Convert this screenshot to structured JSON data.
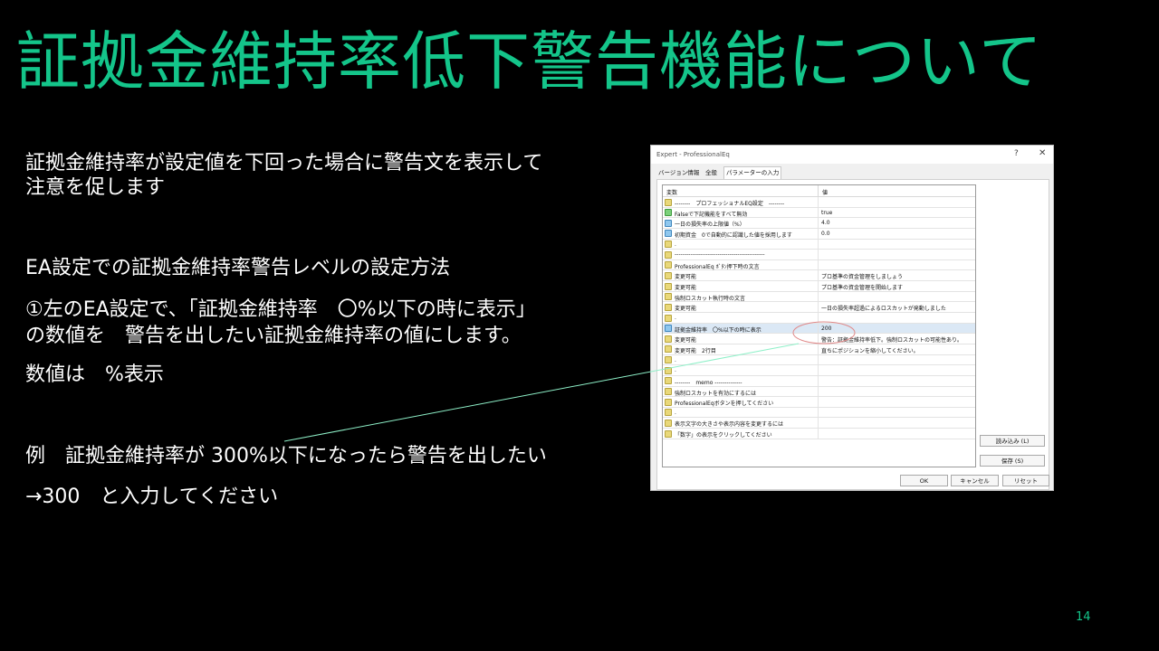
{
  "slide": {
    "title": "証拠金維持率低下警告機能について",
    "page_number": "14",
    "lines": {
      "l1": "証拠金維持率が設定値を下回った場合に警告文を表示して",
      "l2": "注意を促します",
      "l3": "EA設定での証拠金維持率警告レベルの設定方法",
      "l4": "①左のEA設定で、「証拠金維持率　〇%以下の時に表示」",
      "l5": "の数値を　警告を出したい証拠金維持率の値にします。",
      "l6": "数値は　%表示",
      "l7": "例　証拠金維持率が 300%以下になったら警告を出したい",
      "l8": "→300　と入力してください"
    }
  },
  "dialog": {
    "title": "Expert - ProfessionalEq",
    "help": "?",
    "close": "✕",
    "tabs": [
      "バージョン情報",
      "全般",
      "パラメーターの入力"
    ],
    "columns": [
      "変数",
      "値"
    ],
    "rows": [
      {
        "icon": "ab",
        "name": "--------　プロフェッショナルEQ設定　--------",
        "value": ""
      },
      {
        "icon": "bool",
        "name": "Falseで下記機能をすべて無効",
        "value": "true"
      },
      {
        "icon": "num",
        "name": "一日の損失率の上限値（%）",
        "value": "4.0"
      },
      {
        "icon": "num",
        "name": "初期資金　0で自動的に認識した値を採用します",
        "value": "0.0"
      },
      {
        "icon": "ab",
        "name": ".",
        "value": ""
      },
      {
        "icon": "ab",
        "name": "----------------------------------------------",
        "value": ""
      },
      {
        "icon": "ab",
        "name": "ProfessionalEq ﾎﾞﾀﾝ押下時の文言",
        "value": ""
      },
      {
        "icon": "ab",
        "name": "変更可能",
        "value": "プロ基準の資金管理をしましょう"
      },
      {
        "icon": "ab",
        "name": "変更可能",
        "value": "プロ基準の資金管理を開始します"
      },
      {
        "icon": "ab",
        "name": "強制ロスカット執行時の文言",
        "value": ""
      },
      {
        "icon": "ab",
        "name": "変更可能",
        "value": "一日の損失率超過によるロスカットが発動しました"
      },
      {
        "icon": "ab",
        "name": ".",
        "value": ""
      },
      {
        "icon": "num",
        "name": "証拠金維持率　〇%以下の時に表示",
        "value": "200"
      },
      {
        "icon": "ab",
        "name": "変更可能",
        "value": "警告：証拠金維持率低下。強制ロスカットの可能性あり。"
      },
      {
        "icon": "ab",
        "name": "変更可能　2行目",
        "value": "直ちにポジションを縮小してください。"
      },
      {
        "icon": "ab",
        "name": ".",
        "value": ""
      },
      {
        "icon": "ab",
        "name": ".",
        "value": ""
      },
      {
        "icon": "ab",
        "name": "--------　memo --------------",
        "value": ""
      },
      {
        "icon": "ab",
        "name": "強制ロスカットを有効にするには",
        "value": ""
      },
      {
        "icon": "ab",
        "name": "ProfessionalEqボタンを押してください",
        "value": ""
      },
      {
        "icon": "ab",
        "name": ".",
        "value": ""
      },
      {
        "icon": "ab",
        "name": "表示文字の大きさや表示内容を変更するには",
        "value": ""
      },
      {
        "icon": "ab",
        "name": "「数字」の表示をクリックしてください",
        "value": ""
      }
    ],
    "buttons": {
      "load": "読み込み (L)",
      "save": "保存 (S)",
      "ok": "OK",
      "cancel": "キャンセル",
      "reset": "リセット"
    }
  },
  "colors": {
    "title": "#14c58a",
    "annotation_line": "#8ef0c8",
    "annotation_ellipse": "#e08a8a"
  }
}
